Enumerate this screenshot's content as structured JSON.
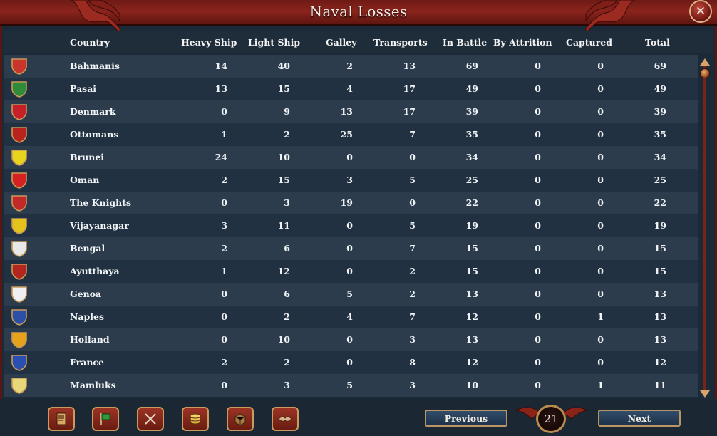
{
  "window": {
    "title": "Naval Losses",
    "close_symbol": "✕"
  },
  "columns": [
    "Country",
    "Heavy Ship",
    "Light Ship",
    "Galley",
    "Transports",
    "In Battle",
    "By Attrition",
    "Captured",
    "Total"
  ],
  "rows": [
    {
      "country": "Bahmanis",
      "heavy": "14",
      "light": "40",
      "galley": "2",
      "transports": "13",
      "in_battle": "69",
      "attrition": "0",
      "captured": "0",
      "total": "69",
      "flag_color": "#c9352a",
      "flag_icon": "bahmanis-flag-icon"
    },
    {
      "country": "Pasai",
      "heavy": "13",
      "light": "15",
      "galley": "4",
      "transports": "17",
      "in_battle": "49",
      "attrition": "0",
      "captured": "0",
      "total": "49",
      "flag_color": "#2f8a3a",
      "flag_icon": "pasai-flag-icon"
    },
    {
      "country": "Denmark",
      "heavy": "0",
      "light": "9",
      "galley": "13",
      "transports": "17",
      "in_battle": "39",
      "attrition": "0",
      "captured": "0",
      "total": "39",
      "flag_color": "#c8202a",
      "flag_icon": "denmark-flag-icon"
    },
    {
      "country": "Ottomans",
      "heavy": "1",
      "light": "2",
      "galley": "25",
      "transports": "7",
      "in_battle": "35",
      "attrition": "0",
      "captured": "0",
      "total": "35",
      "flag_color": "#b8231d",
      "flag_icon": "ottomans-flag-icon"
    },
    {
      "country": "Brunei",
      "heavy": "24",
      "light": "10",
      "galley": "0",
      "transports": "0",
      "in_battle": "34",
      "attrition": "0",
      "captured": "0",
      "total": "34",
      "flag_color": "#e7d41e",
      "flag_icon": "brunei-flag-icon"
    },
    {
      "country": "Oman",
      "heavy": "2",
      "light": "15",
      "galley": "3",
      "transports": "5",
      "in_battle": "25",
      "attrition": "0",
      "captured": "0",
      "total": "25",
      "flag_color": "#d42222",
      "flag_icon": "oman-flag-icon"
    },
    {
      "country": "The Knights",
      "heavy": "0",
      "light": "3",
      "galley": "19",
      "transports": "0",
      "in_battle": "22",
      "attrition": "0",
      "captured": "0",
      "total": "22",
      "flag_color": "#c22a2a",
      "flag_icon": "knights-flag-icon"
    },
    {
      "country": "Vijayanagar",
      "heavy": "3",
      "light": "11",
      "galley": "0",
      "transports": "5",
      "in_battle": "19",
      "attrition": "0",
      "captured": "0",
      "total": "19",
      "flag_color": "#e4c21c",
      "flag_icon": "vijayanagar-flag-icon"
    },
    {
      "country": "Bengal",
      "heavy": "2",
      "light": "6",
      "galley": "0",
      "transports": "7",
      "in_battle": "15",
      "attrition": "0",
      "captured": "0",
      "total": "15",
      "flag_color": "#e8e8e8",
      "flag_icon": "bengal-flag-icon"
    },
    {
      "country": "Ayutthaya",
      "heavy": "1",
      "light": "12",
      "galley": "0",
      "transports": "2",
      "in_battle": "15",
      "attrition": "0",
      "captured": "0",
      "total": "15",
      "flag_color": "#b3261f",
      "flag_icon": "ayutthaya-flag-icon"
    },
    {
      "country": "Genoa",
      "heavy": "0",
      "light": "6",
      "galley": "5",
      "transports": "2",
      "in_battle": "13",
      "attrition": "0",
      "captured": "0",
      "total": "13",
      "flag_color": "#f0f0f0",
      "flag_icon": "genoa-flag-icon"
    },
    {
      "country": "Naples",
      "heavy": "0",
      "light": "2",
      "galley": "4",
      "transports": "7",
      "in_battle": "12",
      "attrition": "0",
      "captured": "1",
      "total": "13",
      "flag_color": "#2c4fa8",
      "flag_icon": "naples-flag-icon"
    },
    {
      "country": "Holland",
      "heavy": "0",
      "light": "10",
      "galley": "0",
      "transports": "3",
      "in_battle": "13",
      "attrition": "0",
      "captured": "0",
      "total": "13",
      "flag_color": "#e6a21a",
      "flag_icon": "holland-flag-icon"
    },
    {
      "country": "France",
      "heavy": "2",
      "light": "2",
      "galley": "0",
      "transports": "8",
      "in_battle": "12",
      "attrition": "0",
      "captured": "0",
      "total": "12",
      "flag_color": "#2a4fb0",
      "flag_icon": "france-flag-icon"
    },
    {
      "country": "Mamluks",
      "heavy": "0",
      "light": "3",
      "galley": "5",
      "transports": "3",
      "in_battle": "10",
      "attrition": "0",
      "captured": "1",
      "total": "11",
      "flag_color": "#e8d87a",
      "flag_icon": "mamluks-flag-icon"
    }
  ],
  "footer": {
    "previous_label": "Previous",
    "next_label": "Next",
    "page_number": "21",
    "tabs": [
      "ledger-icon",
      "flag-icon",
      "crossed-swords-icon",
      "coins-icon",
      "crate-icon",
      "handshake-icon"
    ]
  },
  "colors": {
    "title_bar": "#7a1e17",
    "row_odd": "#2c3c4c",
    "row_even": "#223142",
    "accent_gold": "#c99c5e"
  }
}
